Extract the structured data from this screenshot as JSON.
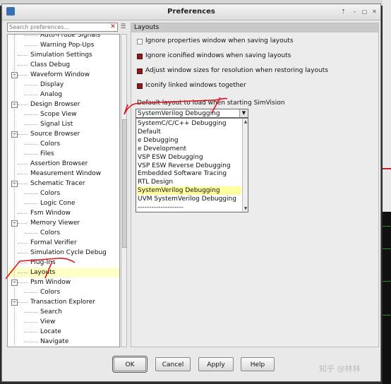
{
  "window": {
    "title": "Preferences",
    "controls": [
      "⇡",
      "–",
      "▢",
      "✕"
    ]
  },
  "search": {
    "placeholder": "Search preferences..."
  },
  "tree": {
    "items": [
      {
        "label": "Auto-Probe Signals",
        "depth": 2,
        "toggle": ""
      },
      {
        "label": "Warning Pop-Ups",
        "depth": 2,
        "toggle": ""
      },
      {
        "label": "Simulation Settings",
        "depth": 1,
        "toggle": ""
      },
      {
        "label": "Class Debug",
        "depth": 1,
        "toggle": ""
      },
      {
        "label": "Waveform Window",
        "depth": 1,
        "toggle": "−"
      },
      {
        "label": "Display",
        "depth": 2,
        "toggle": ""
      },
      {
        "label": "Analog",
        "depth": 2,
        "toggle": ""
      },
      {
        "label": "Design Browser",
        "depth": 1,
        "toggle": "−"
      },
      {
        "label": "Scope View",
        "depth": 2,
        "toggle": ""
      },
      {
        "label": "Signal List",
        "depth": 2,
        "toggle": ""
      },
      {
        "label": "Source Browser",
        "depth": 1,
        "toggle": "−"
      },
      {
        "label": "Colors",
        "depth": 2,
        "toggle": ""
      },
      {
        "label": "Files",
        "depth": 2,
        "toggle": ""
      },
      {
        "label": "Assertion Browser",
        "depth": 1,
        "toggle": ""
      },
      {
        "label": "Measurement Window",
        "depth": 1,
        "toggle": ""
      },
      {
        "label": "Schematic Tracer",
        "depth": 1,
        "toggle": "−"
      },
      {
        "label": "Colors",
        "depth": 2,
        "toggle": ""
      },
      {
        "label": "Logic Cone",
        "depth": 2,
        "toggle": ""
      },
      {
        "label": "Fsm Window",
        "depth": 1,
        "toggle": ""
      },
      {
        "label": "Memory Viewer",
        "depth": 1,
        "toggle": "−"
      },
      {
        "label": "Colors",
        "depth": 2,
        "toggle": ""
      },
      {
        "label": "Formal Verifier",
        "depth": 1,
        "toggle": ""
      },
      {
        "label": "Simulation Cycle Debug",
        "depth": 1,
        "toggle": ""
      },
      {
        "label": "Plug-Ins",
        "depth": 1,
        "toggle": ""
      },
      {
        "label": "Layouts",
        "depth": 1,
        "toggle": "",
        "selected": true
      },
      {
        "label": "Psm Window",
        "depth": 1,
        "toggle": "−"
      },
      {
        "label": "Colors",
        "depth": 2,
        "toggle": ""
      },
      {
        "label": "Transaction Explorer",
        "depth": 1,
        "toggle": "−"
      },
      {
        "label": "Search",
        "depth": 2,
        "toggle": ""
      },
      {
        "label": "View",
        "depth": 2,
        "toggle": ""
      },
      {
        "label": "Locate",
        "depth": 2,
        "toggle": ""
      },
      {
        "label": "Navigate",
        "depth": 2,
        "toggle": ""
      }
    ]
  },
  "layouts": {
    "header": "Layouts",
    "options": [
      {
        "label": "Ignore properties window when saving layouts",
        "checked": false
      },
      {
        "label": "Ignore iconified windows when saving layouts",
        "checked": true
      },
      {
        "label": "Adjust window sizes for resolution when restoring layouts",
        "checked": true
      },
      {
        "label": "Iconify linked windows together",
        "checked": true
      }
    ],
    "default_label": "Default layout to load when starting SimVision",
    "selected": "SystemVerilog Debugging",
    "dropdown_items": [
      "SystemC/C/C++ Debugging",
      "Default",
      "e Debugging",
      "e Development",
      "VSP ESW Debugging",
      "VSP ESW Reverse Debugging",
      "Embedded Software Tracing",
      "RTL Design",
      "SystemVerilog Debugging",
      "UVM SystemVerilog Debugging",
      "--------------------"
    ],
    "highlighted_index": 8
  },
  "buttons": {
    "ok": "OK",
    "cancel": "Cancel",
    "apply": "Apply",
    "help": "Help"
  },
  "watermark": "知乎 @林林",
  "colors": {
    "checked": "#8b1a1a",
    "selection": "#ffffc0",
    "annotation": "#e0141e"
  }
}
